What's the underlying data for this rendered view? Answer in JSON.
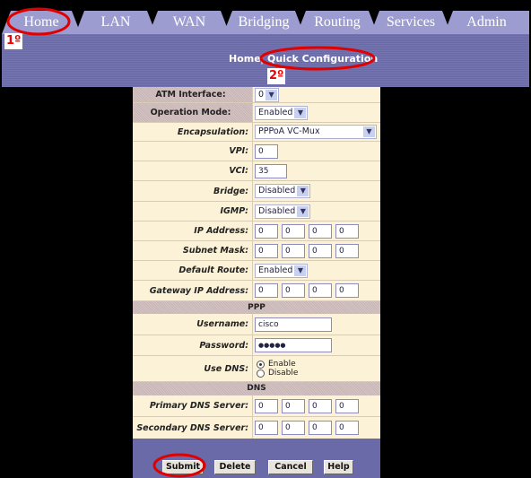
{
  "tabs": [
    {
      "label": "Home"
    },
    {
      "label": "LAN"
    },
    {
      "label": "WAN"
    },
    {
      "label": "Bridging"
    },
    {
      "label": "Routing"
    },
    {
      "label": "Services"
    },
    {
      "label": "Admin"
    }
  ],
  "breadcrumb": {
    "home": "Home",
    "separator": "|",
    "current": "Quick Configuration"
  },
  "annotations": {
    "step1": "1º",
    "step2": "2º",
    "color": "#e00000"
  },
  "form": {
    "atm_interface": {
      "label": "ATM Interface:",
      "value": "0"
    },
    "operation_mode": {
      "label": "Operation Mode:",
      "value": "Enabled"
    },
    "encapsulation": {
      "label": "Encapsulation:",
      "value": "PPPoA VC-Mux"
    },
    "vpi": {
      "label": "VPI:",
      "value": "0"
    },
    "vci": {
      "label": "VCI:",
      "value": "35"
    },
    "bridge": {
      "label": "Bridge:",
      "value": "Disabled"
    },
    "igmp": {
      "label": "IGMP:",
      "value": "Disabled"
    },
    "ip_address": {
      "label": "IP Address:",
      "octets": [
        "0",
        "0",
        "0",
        "0"
      ]
    },
    "subnet_mask": {
      "label": "Subnet Mask:",
      "octets": [
        "0",
        "0",
        "0",
        "0"
      ]
    },
    "default_route": {
      "label": "Default Route:",
      "value": "Enabled"
    },
    "gateway_ip": {
      "label": "Gateway IP Address:",
      "octets": [
        "0",
        "0",
        "0",
        "0"
      ]
    },
    "ppp_header": "PPP",
    "username": {
      "label": "Username:",
      "value": "cisco"
    },
    "password": {
      "label": "Password:",
      "value": "●●●●●"
    },
    "use_dns": {
      "label": "Use DNS:",
      "options": [
        "Enable",
        "Disable"
      ],
      "selected": "Enable"
    },
    "dns_header": "DNS",
    "primary_dns": {
      "label": "Primary DNS Server:",
      "octets": [
        "0",
        "0",
        "0",
        "0"
      ]
    },
    "secondary_dns": {
      "label": "Secondary DNS Server:",
      "octets": [
        "0",
        "0",
        "0",
        "0"
      ]
    }
  },
  "buttons": {
    "submit": "Submit",
    "delete": "Delete",
    "cancel": "Cancel",
    "help": "Help"
  }
}
